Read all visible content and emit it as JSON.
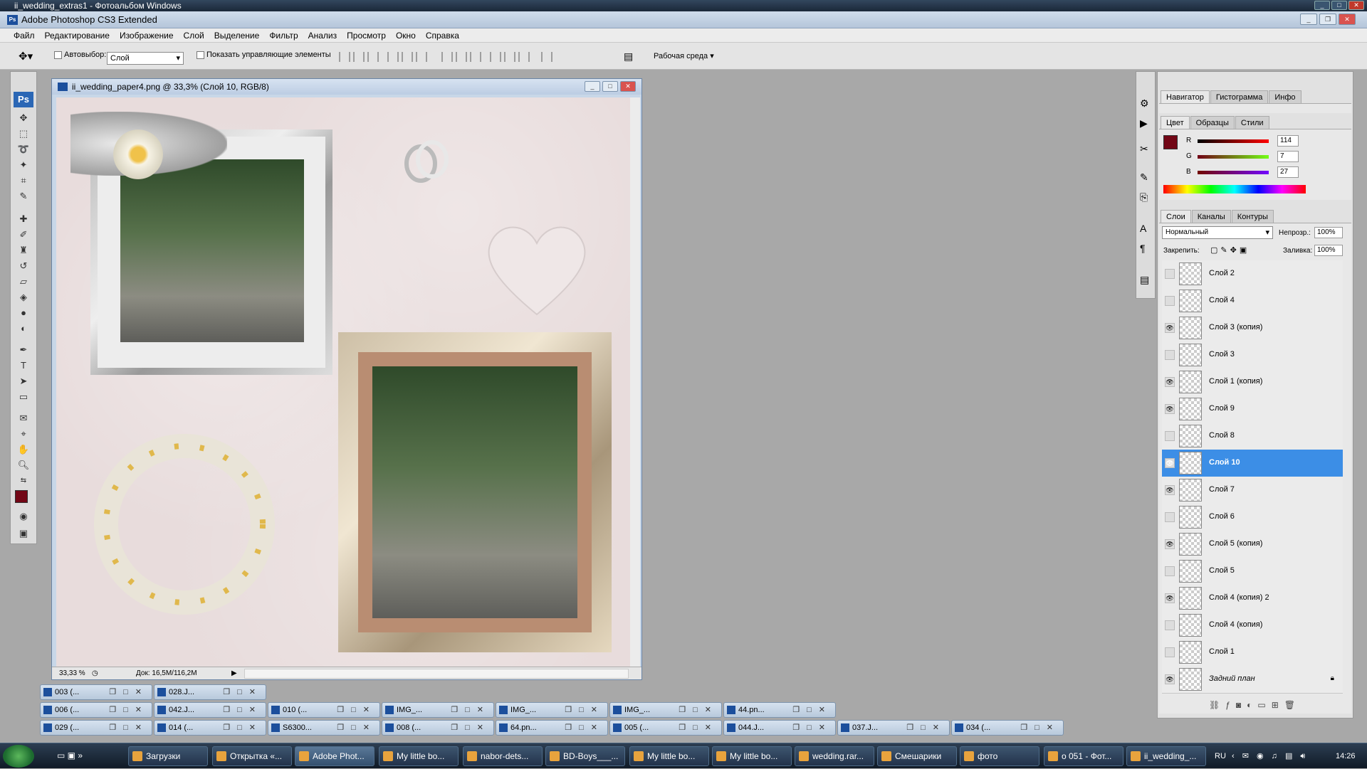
{
  "window": {
    "title": "ii_wedding_extras1 - Фотоальбом Windows"
  },
  "app": {
    "title": "Adobe Photoshop CS3 Extended"
  },
  "menu": [
    "Файл",
    "Редактирование",
    "Изображение",
    "Слой",
    "Выделение",
    "Фильтр",
    "Анализ",
    "Просмотр",
    "Окно",
    "Справка"
  ],
  "options": {
    "autoselect_label": "Автовыбор:",
    "autoselect_value": "Слой",
    "show_controls_label": "Показать управляющие элементы",
    "workspace_label": "Рабочая среда"
  },
  "document": {
    "title": "ii_wedding_paper4.png @ 33,3% (Слой 10, RGB/8)",
    "zoom": "33,33 %",
    "doc_size": "Док: 16,5M/116,2M"
  },
  "panels": {
    "top_tabs": [
      "Навигатор",
      "Гистограмма",
      "Инфо"
    ],
    "color_tabs": [
      "Цвет",
      "Образцы",
      "Стили"
    ],
    "color": {
      "r_label": "R",
      "r": "114",
      "g_label": "G",
      "g": "7",
      "b_label": "B",
      "b": "27",
      "foreground": "#720716"
    },
    "layers_tabs": [
      "Слои",
      "Каналы",
      "Контуры"
    ],
    "blend_mode": "Нормальный",
    "opacity_label": "Непрозр.:",
    "opacity": "100%",
    "lock_label": "Закрепить:",
    "fill_label": "Заливка:",
    "fill": "100%",
    "layers": [
      {
        "name": "Слой 2",
        "visible": false
      },
      {
        "name": "Слой 4",
        "visible": false
      },
      {
        "name": "Слой 3 (копия)",
        "visible": true
      },
      {
        "name": "Слой 3",
        "visible": false
      },
      {
        "name": "Слой 1 (копия)",
        "visible": true
      },
      {
        "name": "Слой 9",
        "visible": true
      },
      {
        "name": "Слой 8",
        "visible": false
      },
      {
        "name": "Слой 10",
        "visible": true,
        "active": true
      },
      {
        "name": "Слой 7",
        "visible": true
      },
      {
        "name": "Слой 6",
        "visible": false
      },
      {
        "name": "Слой 5 (копия)",
        "visible": true
      },
      {
        "name": "Слой 5",
        "visible": false
      },
      {
        "name": "Слой 4 (копия) 2",
        "visible": true
      },
      {
        "name": "Слой 4 (копия)",
        "visible": false
      },
      {
        "name": "Слой 1",
        "visible": false
      },
      {
        "name": "Задний план",
        "visible": true,
        "locked": true
      }
    ]
  },
  "minimized_docs": [
    [
      "003 (...",
      "028.J..."
    ],
    [
      "006 (...",
      "042.J...",
      "010 (...",
      "IMG_...",
      "IMG_...",
      "IMG_...",
      "44.pn..."
    ],
    [
      "029 (...",
      "014 (...",
      "S6300...",
      "008 (...",
      "64.pn...",
      "005 (...",
      "044.J...",
      "037.J...",
      "034 (..."
    ]
  ],
  "taskbar": {
    "items": [
      "Загрузки",
      "Открытка «...",
      "Adobe Phot...",
      "My little bo...",
      "nabor-dets...",
      "BD-Boys___...",
      "My little bo...",
      "My little bo...",
      "wedding.rar...",
      "Смешарики",
      "фото",
      "о 051 - Фот...",
      "ii_wedding_..."
    ],
    "active_index": 2,
    "lang": "RU",
    "time": "14:26"
  }
}
